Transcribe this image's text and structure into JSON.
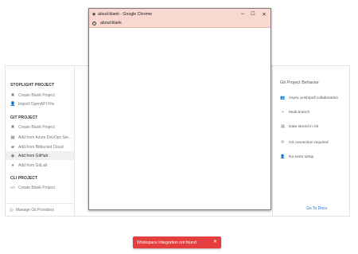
{
  "sidebar": {
    "sections": [
      {
        "title": "STOPLIGHT PROJECT",
        "items": [
          {
            "icon": "x-icon",
            "glyph": "✖",
            "label": "Create Blank Project"
          },
          {
            "icon": "user-import-icon",
            "glyph": "👤",
            "label": "Import OpenAPI File"
          }
        ]
      },
      {
        "title": "GIT PROJECT",
        "items": [
          {
            "icon": "x-icon",
            "glyph": "✖",
            "label": "Create Blank Project"
          },
          {
            "icon": "server-icon",
            "glyph": "▦",
            "label": "Add from Azure DevOps Ser..."
          },
          {
            "icon": "bitbucket-icon",
            "glyph": "▰",
            "label": "Add from Bitbucket Cloud"
          },
          {
            "icon": "github-icon",
            "glyph": "◉",
            "label": "Add from GitHub"
          },
          {
            "icon": "gitlab-icon",
            "glyph": "♦",
            "label": "Add from GitLab"
          }
        ]
      },
      {
        "title": "CLI PROJECT",
        "items": [
          {
            "icon": "code-icon",
            "glyph": "</>",
            "label": "Create Blank Project"
          }
        ]
      }
    ],
    "manage_label": "Manage Git Providers",
    "manage_glyph": "◎"
  },
  "behavior": {
    "title": "Git Project Behavior",
    "items": [
      {
        "icon": "users-icon",
        "glyph": "👥",
        "label": "Async push/pull collaboration"
      },
      {
        "icon": "branch-icon",
        "glyph": "⑂",
        "label": "Multi branch"
      },
      {
        "icon": "database-icon",
        "glyph": "▤",
        "label": "Data stored in Git"
      },
      {
        "icon": "sync-icon",
        "glyph": "⟳",
        "label": "Git connection required"
      },
      {
        "icon": "user-icon",
        "glyph": "👤",
        "label": "No extra setup"
      }
    ],
    "link_label": "Go To Docs"
  },
  "browser": {
    "title": "about:blank - Google Chrome",
    "url": "about:blank",
    "minimize": "─",
    "maximize": "☐",
    "close": "✕",
    "favicon": "◉",
    "info": "i"
  },
  "toast": {
    "message": "Workspace Integration not found",
    "close": "✕"
  },
  "colors": {
    "chrome_frame": "#f8d8cf",
    "toast_bg": "#e53e3e",
    "link": "#1a73c7"
  }
}
